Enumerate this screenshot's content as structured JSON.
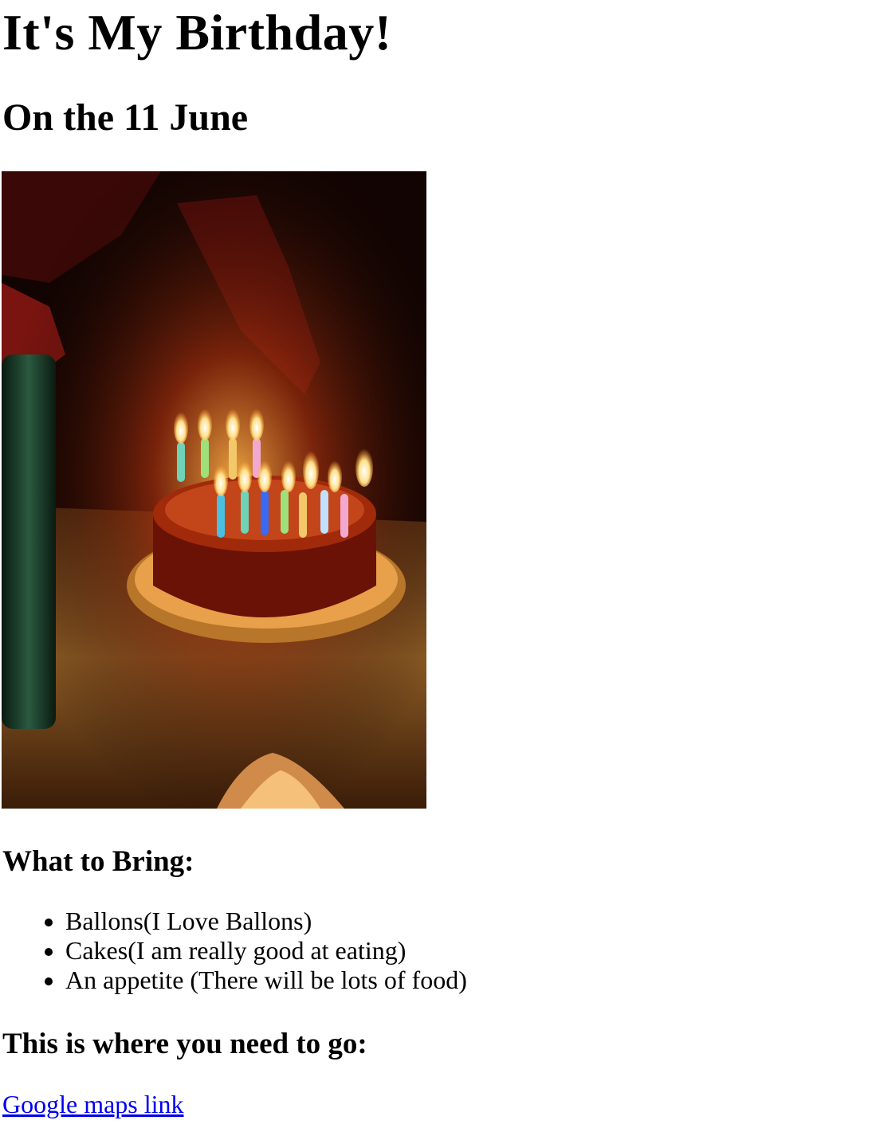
{
  "page": {
    "title": "It's My Birthday!",
    "subtitle": "On the 11 June"
  },
  "photo": {
    "icon": "birthday-cake-photo"
  },
  "bring": {
    "heading": "What to Bring:",
    "items": [
      "Ballons(I Love Ballons)",
      "Cakes(I am really good at eating)",
      "An appetite (There will be lots of food)"
    ]
  },
  "location": {
    "heading": "This is where you need to go:",
    "link_text": "Google maps link"
  },
  "colors": {
    "link": "#0000ee",
    "text": "#000000",
    "background": "#ffffff"
  }
}
